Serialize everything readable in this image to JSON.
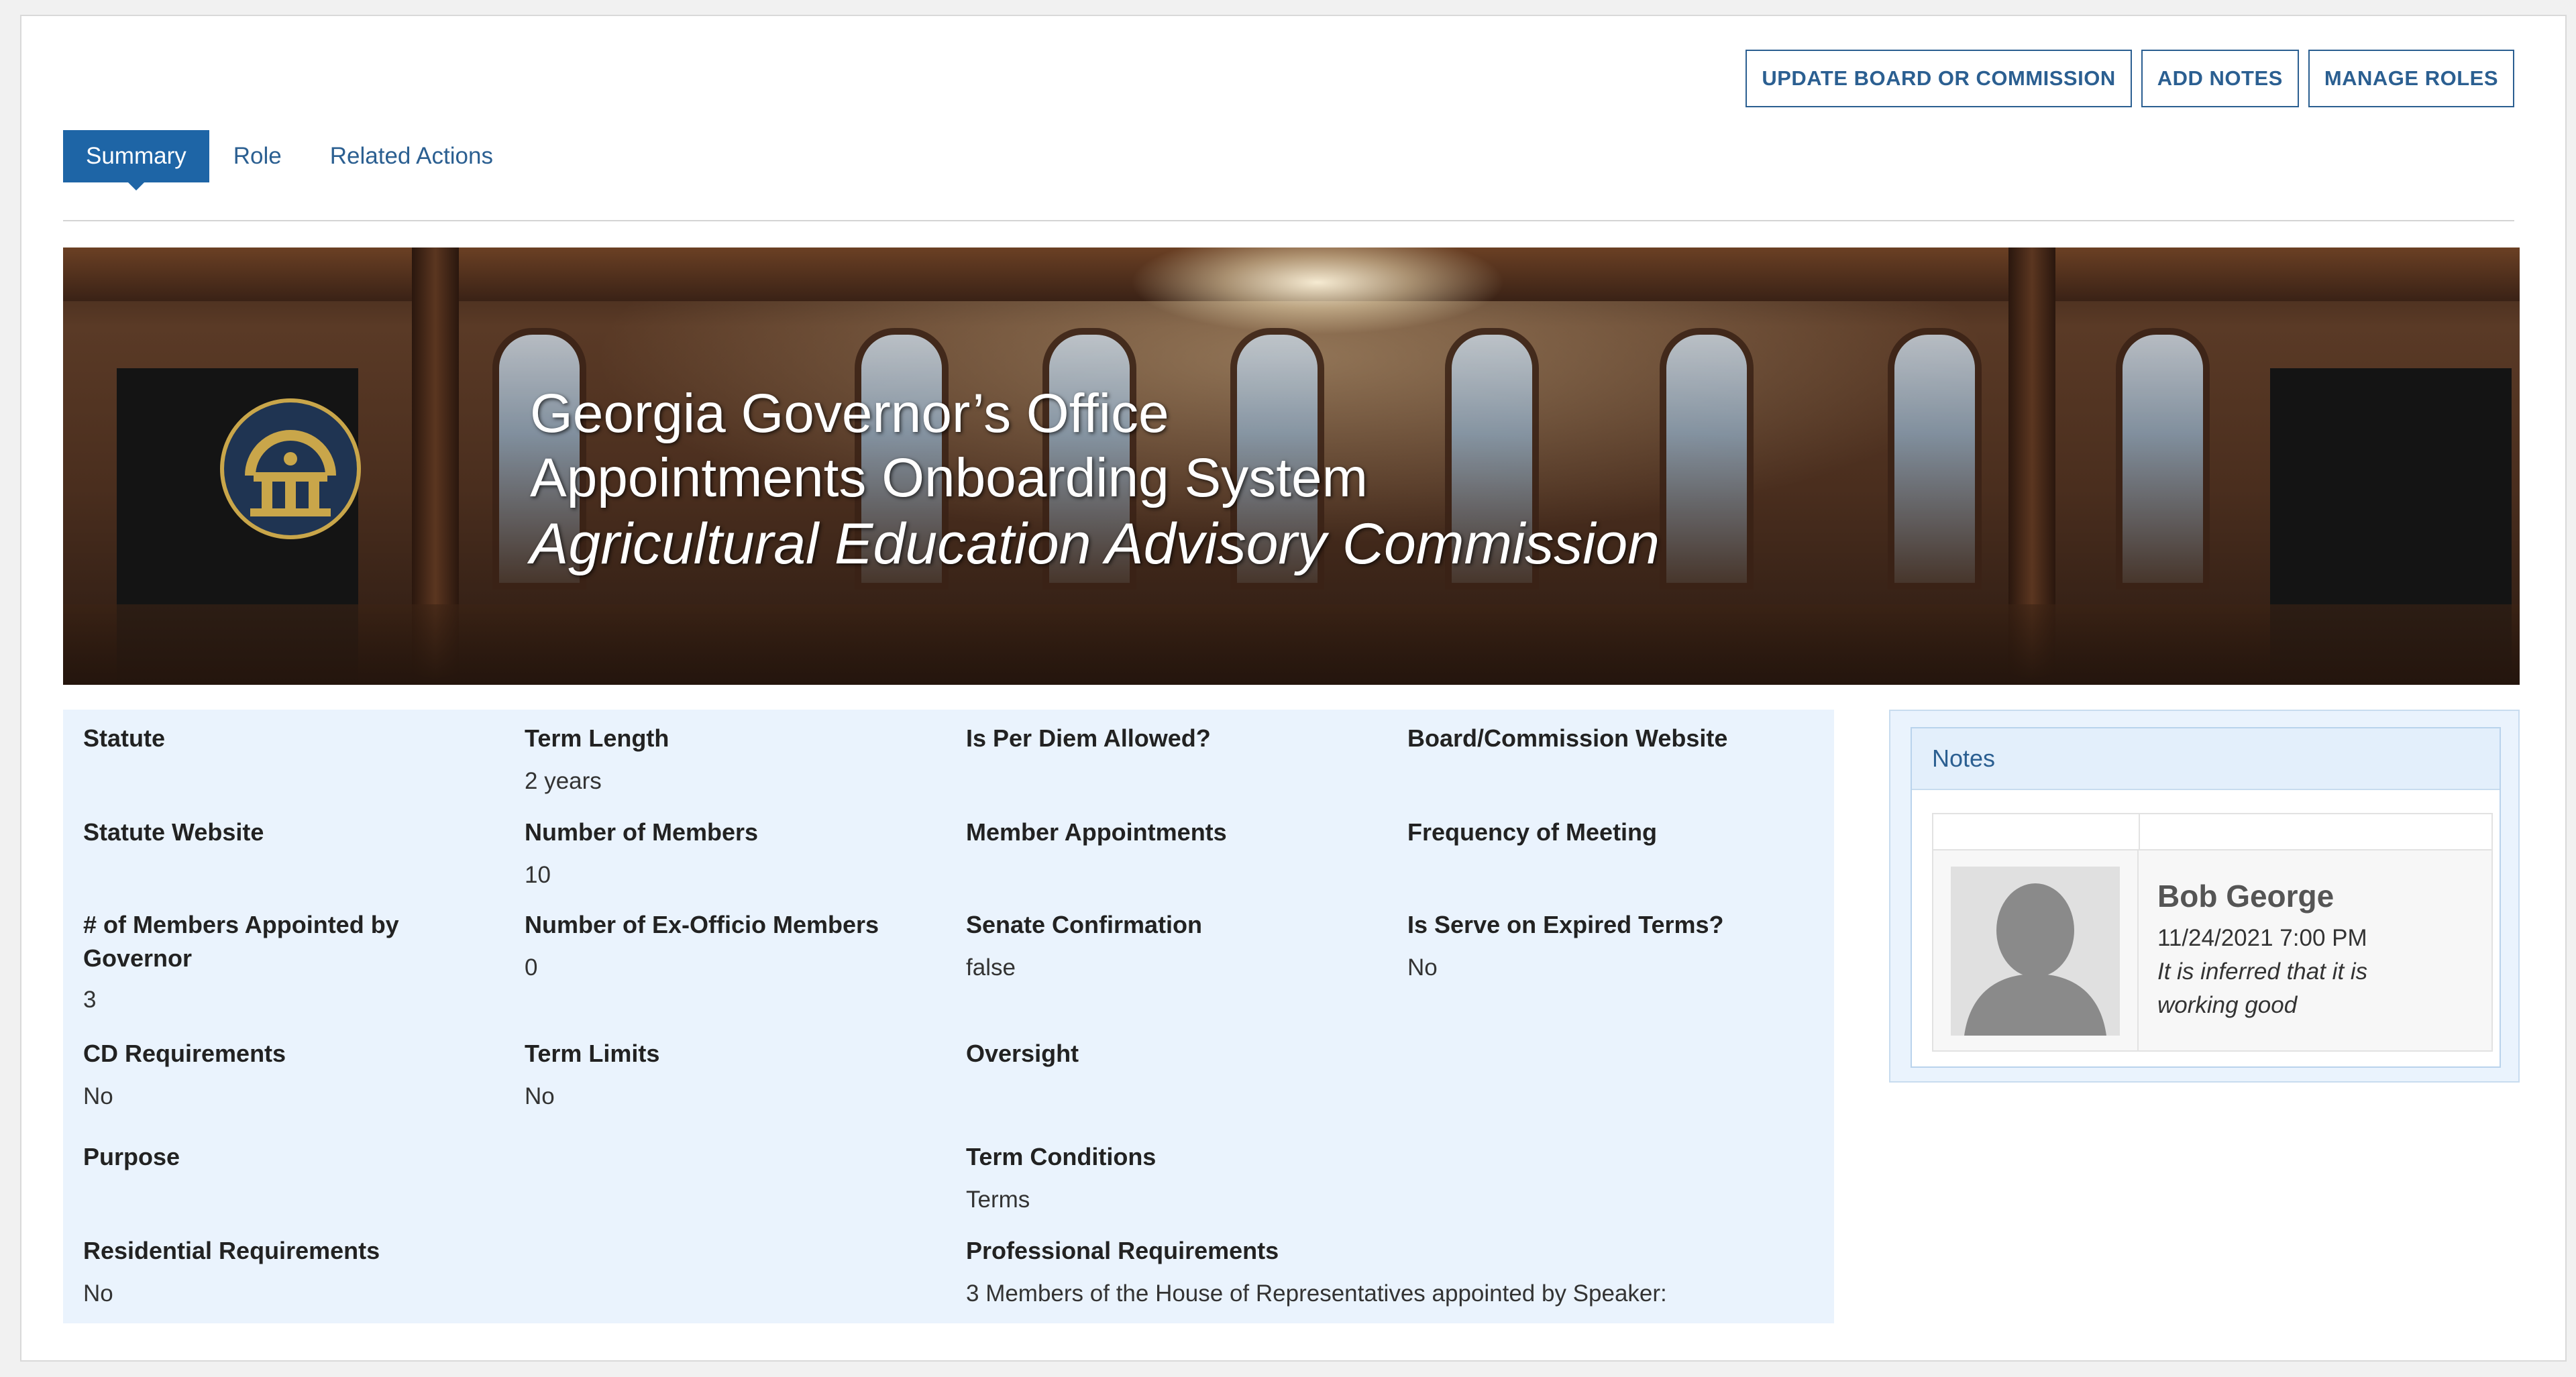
{
  "toolbar": {
    "update_label": "UPDATE BOARD OR COMMISSION",
    "add_notes_label": "ADD NOTES",
    "manage_roles_label": "MANAGE ROLES"
  },
  "tabs": [
    {
      "label": "Summary",
      "active": true
    },
    {
      "label": "Role",
      "active": false
    },
    {
      "label": "Related Actions",
      "active": false
    }
  ],
  "banner": {
    "line1": "Georgia Governor’s Office",
    "line2": "Appointments Onboarding System",
    "line3": "Agricultural Education Advisory Commission",
    "seal_icon": "georgia-seal-icon",
    "seal_colors": {
      "gold": "#c9a64a",
      "navy": "#1f3452"
    }
  },
  "fields": {
    "statute": {
      "label": "Statute",
      "value": ""
    },
    "term_length": {
      "label": "Term Length",
      "value": "2 years"
    },
    "per_diem": {
      "label": "Is Per Diem Allowed?",
      "value": ""
    },
    "website": {
      "label": "Board/Commission Website",
      "value": ""
    },
    "statute_website": {
      "label": "Statute Website",
      "value": ""
    },
    "num_members": {
      "label": "Number of Members",
      "value": "10"
    },
    "member_appointments": {
      "label": "Member Appointments",
      "value": ""
    },
    "frequency": {
      "label": "Frequency of Meeting",
      "value": ""
    },
    "members_by_governor": {
      "label": "# of Members Appointed by Governor",
      "value": "3"
    },
    "ex_officio": {
      "label": "Number of Ex-Officio Members",
      "value": "0"
    },
    "senate": {
      "label": "Senate Confirmation",
      "value": "false"
    },
    "serve_expired": {
      "label": "Is Serve on Expired Terms?",
      "value": "No"
    },
    "cd_requirements": {
      "label": "CD Requirements",
      "value": "No"
    },
    "term_limits": {
      "label": "Term Limits",
      "value": "No"
    },
    "oversight": {
      "label": "Oversight",
      "value": ""
    },
    "purpose": {
      "label": "Purpose",
      "value": ""
    },
    "term_conditions": {
      "label": "Term Conditions",
      "value": "Terms"
    },
    "residential": {
      "label": "Residential Requirements",
      "value": "No"
    },
    "professional": {
      "label": "Professional Requirements",
      "value": "3 Members of the House of Representatives appointed by Speaker:"
    }
  },
  "notes": {
    "title": "Notes",
    "items": [
      {
        "author": "Bob George",
        "date": "11/24/2021 7:00 PM",
        "text": "It is inferred that it is working good",
        "avatar_icon": "user-silhouette-icon"
      }
    ]
  },
  "colors": {
    "accent": "#1e65a6",
    "link": "#2b5f91",
    "info_bg": "#eaf3fd"
  }
}
